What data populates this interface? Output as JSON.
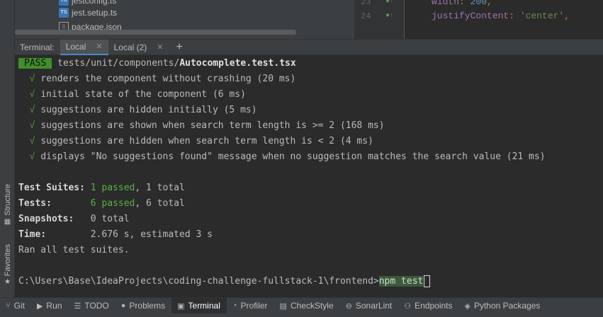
{
  "sidebar": {
    "structure_label": "Structure",
    "favorites_label": "Favorites"
  },
  "project_tree": {
    "items": [
      {
        "name": "jest.config.ts",
        "icon": "ts-file-icon",
        "display": "jestconfig.ts"
      },
      {
        "name": "jest.setup.ts",
        "icon": "ts-file-icon",
        "display": "jest.setup.ts"
      },
      {
        "name": "package.json",
        "icon": "json-file-icon",
        "display": "package.json"
      }
    ]
  },
  "editor": {
    "lines": [
      {
        "number": "23",
        "key": "width",
        "sep": ": ",
        "value": "200",
        "end": ","
      },
      {
        "number": "24",
        "key": "justifyContent",
        "sep": ": ",
        "value": "'center'",
        "end": ","
      }
    ]
  },
  "terminal_tabs": {
    "label": "Terminal:",
    "tabs": [
      {
        "label": "Local",
        "active": true
      },
      {
        "label": "Local (2)",
        "active": false
      }
    ],
    "add_label": "+"
  },
  "terminal": {
    "pass_badge": "PASS",
    "test_path_prefix": "tests/unit/components/",
    "test_file": "Autocomplete.test.tsx",
    "check_mark": "√",
    "results": [
      "renders the component without crashing (20 ms)",
      "initial state of the component (6 ms)",
      "suggestions are hidden initially (5 ms)",
      "suggestions are shown when search term length is >= 2 (168 ms)",
      "suggestions are hidden when search term length is < 2 (4 ms)",
      "displays \"No suggestions found\" message when no suggestion matches the search value (21 ms)"
    ],
    "summary": {
      "suites_label": "Test Suites:",
      "suites_passed": "1 passed",
      "suites_total": ", 1 total",
      "tests_label": "Tests:",
      "tests_passed": "6 passed",
      "tests_total": ", 6 total",
      "snapshots_label": "Snapshots:",
      "snapshots_value": "0 total",
      "time_label": "Time:",
      "time_value": "2.676 s, estimated 3 s",
      "ran_all": "Ran all test suites."
    },
    "prompt": "C:\\Users\\Base\\IdeaProjects\\coding-challenge-fullstack-1\\frontend>",
    "command": "npm test"
  },
  "bottom_bar": {
    "items": [
      {
        "label": "Git",
        "icon": "git-icon",
        "active": false
      },
      {
        "label": "Run",
        "icon": "run-icon",
        "active": false
      },
      {
        "label": "TODO",
        "icon": "todo-icon",
        "active": false
      },
      {
        "label": "Problems",
        "icon": "problems-icon",
        "active": false
      },
      {
        "label": "Terminal",
        "icon": "terminal-icon",
        "active": true
      },
      {
        "label": "Profiler",
        "icon": "profiler-icon",
        "active": false
      },
      {
        "label": "CheckStyle",
        "icon": "checkstyle-icon",
        "active": false
      },
      {
        "label": "SonarLint",
        "icon": "sonarlint-icon",
        "active": false
      },
      {
        "label": "Endpoints",
        "icon": "endpoints-icon",
        "active": false
      },
      {
        "label": "Python Packages",
        "icon": "python-packages-icon",
        "active": false
      }
    ]
  },
  "colors": {
    "pass_badge_bg": "#3f8f2b",
    "check_green": "#4c9a3a",
    "passed_green": "#5bb246",
    "active_tab_underline": "#4a88c7"
  }
}
